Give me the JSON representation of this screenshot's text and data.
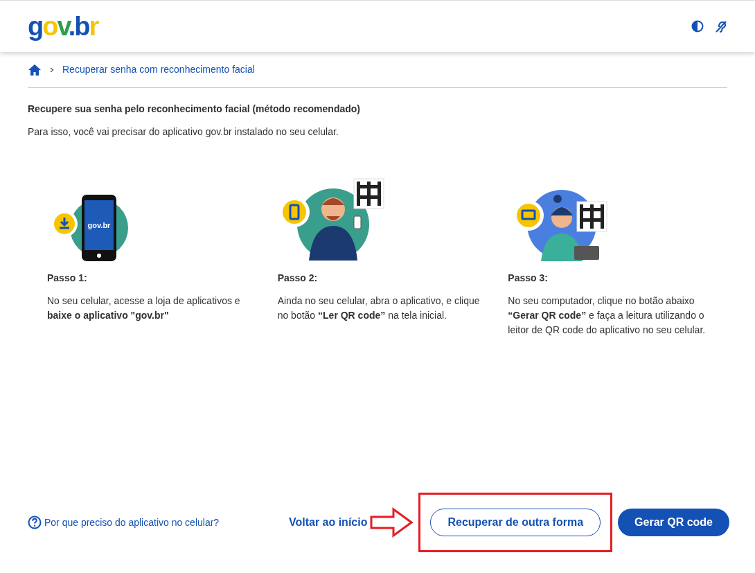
{
  "header": {
    "logo": "gov.br"
  },
  "breadcrumb": {
    "current": "Recuperar senha com reconhecimento facial"
  },
  "heading": "Recupere sua senha pelo reconhecimento facial (método recomendado)",
  "intro": "Para isso, você vai precisar do aplicativo gov.br instalado no seu celular.",
  "steps": [
    {
      "kind": "phone",
      "phone_logo": "gov.br",
      "title": "Passo 1:",
      "text": "No seu celular, acesse a loja de aplicativos e **baixe o aplicativo \"gov.br\"**"
    },
    {
      "kind": "man",
      "title": "Passo 2:",
      "text": "Ainda no seu celular, abra o aplicativo, e clique no botão **“Ler QR code”** na tela inicial."
    },
    {
      "kind": "woman",
      "title": "Passo 3:",
      "text": "No seu computador, clique no botão abaixo **“Gerar QR code”** e faça a leitura utilizando o leitor de QR code do aplicativo no seu celular."
    }
  ],
  "footer": {
    "help_link": "Por que preciso do aplicativo no celular?",
    "back_link": "Voltar ao início",
    "secondary_button": "Recuperar de outra forma",
    "primary_button": "Gerar QR code"
  }
}
